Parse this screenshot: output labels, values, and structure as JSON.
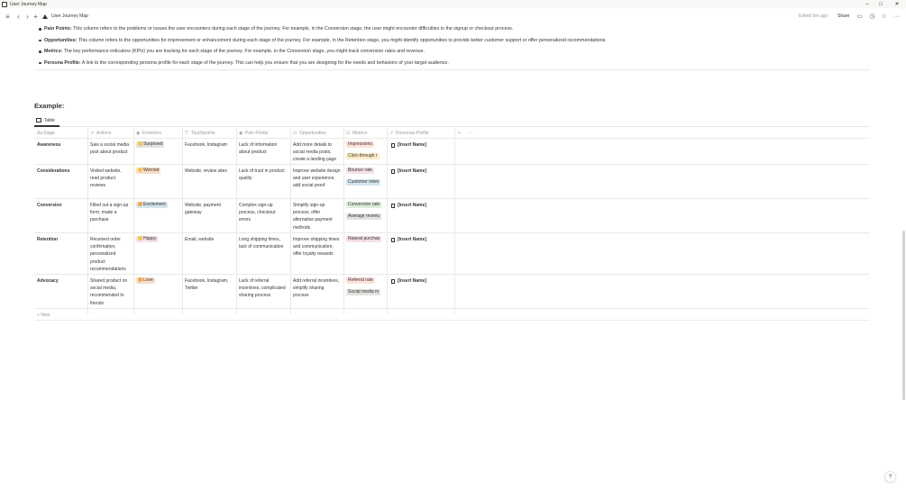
{
  "window": {
    "title": "User Journey Map"
  },
  "topbar": {
    "breadcrumb": "User Journey Map",
    "edited": "Edited 6m ago",
    "share_label": "Share"
  },
  "bullets": [
    {
      "label": "Pain Points:",
      "text": " This column refers to the problems or issues the user encounters during each stage of the journey. For example, in the Conversion stage, the user might encounter difficulties in the signup or checkout process."
    },
    {
      "label": "Opportunities:",
      "text": " This column refers to the opportunities for improvement or enhancement during each stage of the journey. For example, in the Retention stage, you might identify opportunities to provide better customer support or offer personalized recommendations."
    },
    {
      "label": "Metrics:",
      "text": " The key performance indicators (KPIs) you are tracking for each stage of the journey. For example, in the Conversion stage, you might track conversion rates and revenue."
    },
    {
      "label": "Persona Profile:",
      "text": " A link to the corresponding persona profile for each stage of the journey. This can help you ensure that you are designing for the needs and behaviors of your target audience."
    }
  ],
  "example_title": "Example:",
  "view_tab": "Table",
  "columns": [
    "Stage",
    "Actions",
    "Emotions",
    "Touchpoints",
    "Pain Points",
    "Opportunities",
    "Metrics",
    "Personas Profile"
  ],
  "column_icons": [
    "Aa",
    "↗",
    "◉",
    "⛉",
    "◉",
    "☷",
    "☷",
    "↗"
  ],
  "add_column": "+",
  "more_icon": "···",
  "new_row": "+ New",
  "rows": [
    {
      "stage": "Awareness",
      "actions": "Saw a social media post about product",
      "emotion": "Surprised",
      "touchpoints": "Facebook, Instagram",
      "pain": "Lack of information about product",
      "opportunities": "Add more details to social media posts, create a landing page",
      "metrics": [
        "Impressions",
        "Click-through r"
      ],
      "persona": "[Insert Name]"
    },
    {
      "stage": "Considerations",
      "actions": "Visited website, read product reviews",
      "emotion": "Worried",
      "touchpoints": "Website, review sites",
      "pain": "Lack of trust in product quality",
      "opportunities": "Improve website design and user experience, add social proof",
      "metrics": [
        "Bounce rate",
        "Customer reten"
      ],
      "persona": "[Insert Name]"
    },
    {
      "stage": "Conversion",
      "actions": "Filled out a sign-up form, made a purchase",
      "emotion": "Excitement",
      "touchpoints": "Website, payment gateway",
      "pain": "Complex sign-up process, checkout errors",
      "opportunities": "Simplify sign-up process, offer alternative payment methods",
      "metrics": [
        "Conversion rate",
        "Average revenu"
      ],
      "persona": "[Insert Name]"
    },
    {
      "stage": "Retention",
      "actions": "Received order confirmation, personalized product recommendations",
      "emotion": "Happy",
      "touchpoints": "Email, website",
      "pain": "Long shipping times, lack of communication",
      "opportunities": "Improve shipping times and communication, offer loyalty rewards",
      "metrics": [
        "Repeat purchas"
      ],
      "persona": "[Insert Name]"
    },
    {
      "stage": "Advocacy",
      "actions": "Shared product on social media, recommended to friends",
      "emotion": "Love",
      "touchpoints": "Facebook, Instagram, Twitter",
      "pain": "Lack of referral incentives, complicated sharing process",
      "opportunities": "Add referral incentives, simplify sharing process",
      "metrics": [
        "Referral rate",
        "Social media m"
      ],
      "persona": "[Insert Name]"
    }
  ],
  "colors": {
    "emotion_bg": [
      "#e3e2e0",
      "#fadec9",
      "#d3e5ef",
      "#f5e0e9",
      "#fadec9"
    ],
    "metric_bg": [
      [
        "#ffe2dd",
        "#fdecc8"
      ],
      [
        "#f5e0e9",
        "#d3e5ef"
      ],
      [
        "#dbeddb",
        "#e3e2e0"
      ],
      [
        "#f5e0e9"
      ],
      [
        "#ffe2dd",
        "#e3e2e0"
      ]
    ],
    "emoji": [
      "#f5c542",
      "#f5c542",
      "#f5a442",
      "#f5c542",
      "#f5a442"
    ]
  },
  "help_label": "?"
}
